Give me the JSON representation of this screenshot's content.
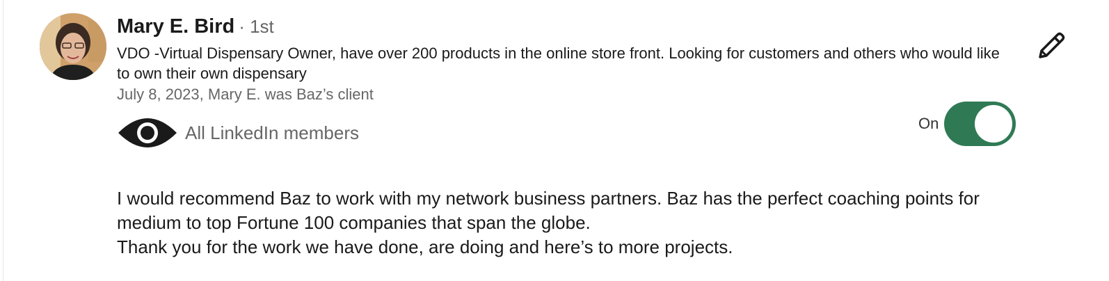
{
  "recommendation": {
    "author": {
      "name": "Mary E. Bird",
      "degree": "· 1st",
      "headline": "VDO -Virtual Dispensary Owner, have over 200 products in the online store front. Looking for customers and others who would like to own their own dispensary",
      "meta": "July 8, 2023, Mary E. was Baz’s client"
    },
    "visibility": {
      "icon": "eye-icon",
      "label": "All LinkedIn members"
    },
    "toggle": {
      "state_label": "On",
      "is_on": true,
      "accent_color": "#2f7a55"
    },
    "edit": {
      "icon": "pencil-icon"
    },
    "text": [
      "I would recommend Baz to work with my network business partners. Baz has the perfect coaching points for medium to top Fortune 100 companies that span the globe.",
      "Thank you for the work we have done, are doing and here’s to more projects."
    ]
  }
}
